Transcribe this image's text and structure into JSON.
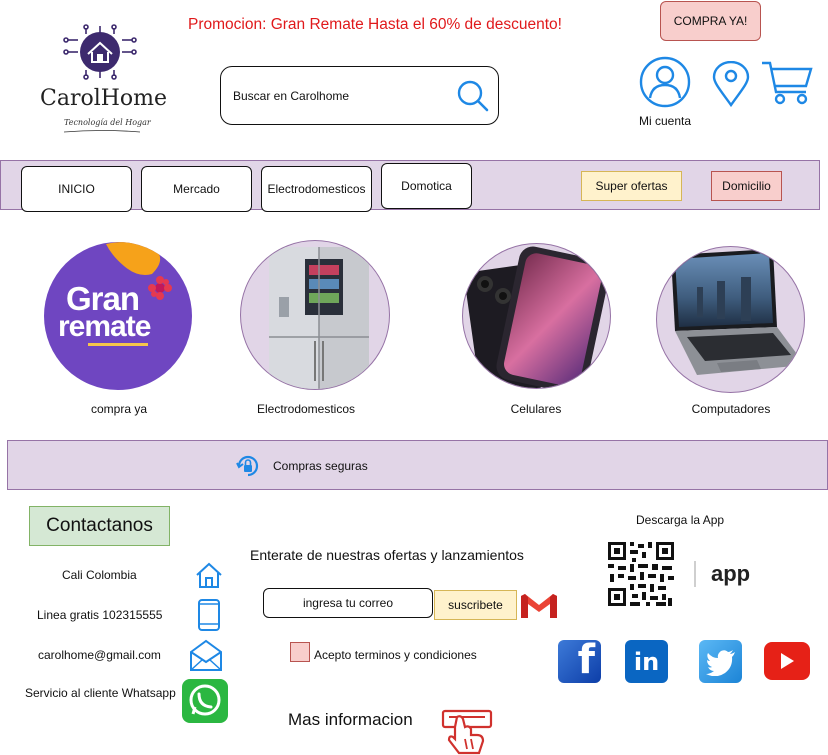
{
  "header": {
    "promo_text": "Promocion: Gran Remate Hasta el 60% de descuento!",
    "cta_label": "COMPRA YA!",
    "logo": {
      "brand": "CarolHome",
      "tagline": "Tecnología del Hogar"
    },
    "search": {
      "placeholder": "Buscar en Carolhome"
    },
    "account_label": "Mi cuenta"
  },
  "nav": {
    "items": [
      {
        "label": "INICIO"
      },
      {
        "label": "Mercado"
      },
      {
        "label": "Electrodomesticos"
      },
      {
        "label": "Domotica"
      }
    ],
    "offers_label": "Super ofertas",
    "delivery_label": "Domicilio"
  },
  "categories": [
    {
      "label": "compra ya",
      "image_text_1": "Gran",
      "image_text_2": "remate"
    },
    {
      "label": "Electrodomesticos"
    },
    {
      "label": "Celulares"
    },
    {
      "label": "Computadores"
    }
  ],
  "secure": {
    "label": "Compras seguras"
  },
  "contact": {
    "title": "Contactanos",
    "items": [
      {
        "label": "Cali Colombia",
        "icon": "home-icon"
      },
      {
        "label": "Linea gratis 102315555",
        "icon": "phone-icon"
      },
      {
        "label": "carolhome@gmail.com",
        "icon": "envelope-icon"
      },
      {
        "label": "Servicio al cliente Whatsapp",
        "icon": "whatsapp-icon"
      }
    ]
  },
  "newsletter": {
    "title": "Enterate de nuestras ofertas y lanzamientos",
    "email_placeholder": "ingresa tu correo",
    "subscribe_label": "suscribete",
    "terms_label": "Acepto terminos y condiciones",
    "more_info_label": "Mas informacion"
  },
  "app": {
    "title": "Descarga la App",
    "app_word": "app"
  },
  "colors": {
    "purple_fill": "#e1d5e7",
    "purple_border": "#9673a6",
    "red_fill": "#f8cecc",
    "yellow_fill": "#fff2cc",
    "green_fill": "#d5e8d4",
    "icon_blue": "#1e88e5",
    "promo_red": "#e0191b"
  }
}
